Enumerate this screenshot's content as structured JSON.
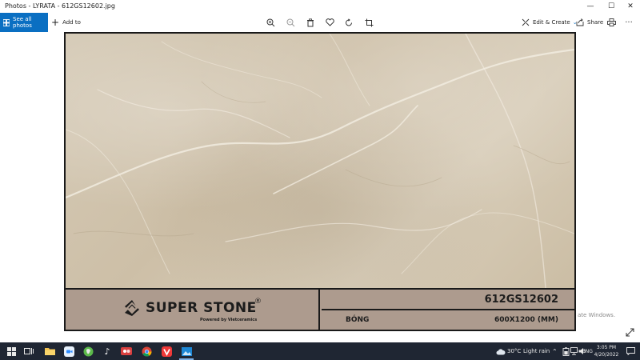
{
  "window": {
    "title": "Photos - LYRATA - 612GS12602.jpg",
    "minimize": "—",
    "maximize": "☐",
    "close": "✕"
  },
  "toolbar": {
    "see_all_photos": "See all photos",
    "add_to": "Add to",
    "edit_create": "Edit & Create",
    "share": "Share"
  },
  "photo": {
    "brand": "SUPER STONE",
    "registered_mark": "®",
    "brand_tagline": "Powered by Vietceramics",
    "product_code": "612GS12602",
    "finish": "BÓNG",
    "size": "600X1200 (MM)"
  },
  "watermark": {
    "line1": "ate Windows."
  },
  "taskbar": {
    "temperature": "30°C",
    "weather": "Light rain",
    "language": "ENG",
    "time": "3:05 PM",
    "date": "4/20/2022"
  },
  "colors": {
    "accent": "#0a6fc2",
    "taskbar": "#1f2633",
    "label_band": "#ad9b8e"
  }
}
